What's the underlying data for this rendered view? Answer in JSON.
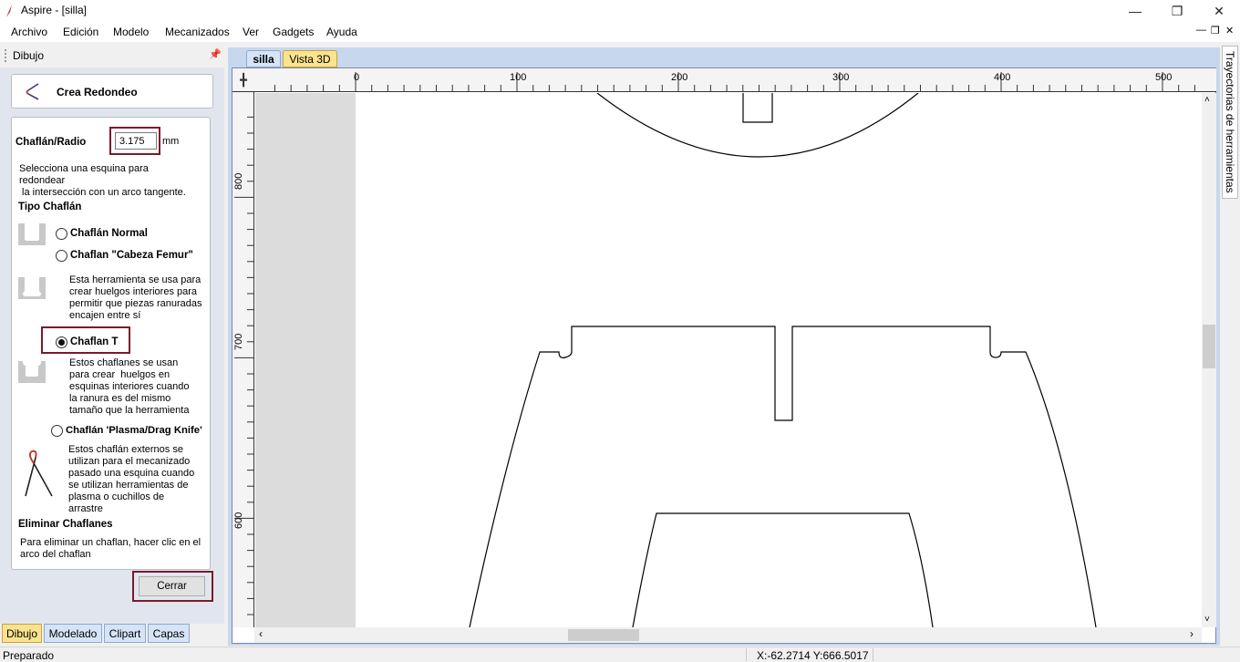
{
  "window": {
    "title": "Aspire - [silla]"
  },
  "menu": [
    "Archivo",
    "Edición",
    "Modelo",
    "Mecanizados",
    "Ver",
    "Gadgets",
    "Ayuda"
  ],
  "panel": {
    "title": "Dibujo",
    "tool_title": "Crea Redondeo",
    "radius_label": "Chaflán/Radio",
    "radius_value": "3.175",
    "radius_unit": "mm",
    "instructions": [
      "Selecciona una esquina para",
      "redondear",
      " la intersección con un arco tangente."
    ],
    "type_heading": "Tipo Chaflán",
    "options": [
      {
        "label": "Chaflán Normal",
        "selected": false
      },
      {
        "label": "Chaflan \"Cabeza Femur\"",
        "selected": false,
        "desc": [
          "Esta herramienta se usa para",
          "crear huelgos interiores para",
          "permitir que piezas ranuradas",
          "encajen entre sí"
        ]
      },
      {
        "label": "Chaflan T",
        "selected": true,
        "desc": [
          "Estos chaflanes se usan",
          "para crear  huelgos en",
          "esquinas interiores cuando",
          "la ranura es del mismo",
          "tamaño que la herramienta"
        ]
      },
      {
        "label": "Chaflán 'Plasma/Drag Knife'",
        "selected": false,
        "desc": [
          "Estos chaflán externos se",
          "utilizan para el mecanizado",
          "pasado una esquina cuando",
          "se utilizan herramientas de",
          "plasma o cuchillos de",
          "arrastre"
        ]
      }
    ],
    "remove_heading": "Eliminar Chaflanes",
    "remove_desc": [
      "Para eliminar un chaflan, hacer clic en el",
      "arco del chaflan"
    ],
    "close_label": "Cerrar",
    "bottom_tabs": [
      "Dibujo",
      "Modelado",
      "Clipart",
      "Capas"
    ]
  },
  "doc_tabs": [
    "silla",
    "Vista 3D"
  ],
  "ruler": {
    "h_labels": [
      "0",
      "100",
      "200",
      "300",
      "400",
      "500"
    ],
    "v_labels": [
      "800",
      "700",
      "600"
    ]
  },
  "side_tab": "Trayectorias de herramientas",
  "status": {
    "text": "Preparado",
    "coords": "X:-62.2714 Y:666.5017"
  },
  "colors": {
    "highlight": "#7b1a2a",
    "active_tab": "#d6e4f7",
    "inactive_tab": "#fbe38e",
    "panel_bg": "#e1e6ee"
  }
}
